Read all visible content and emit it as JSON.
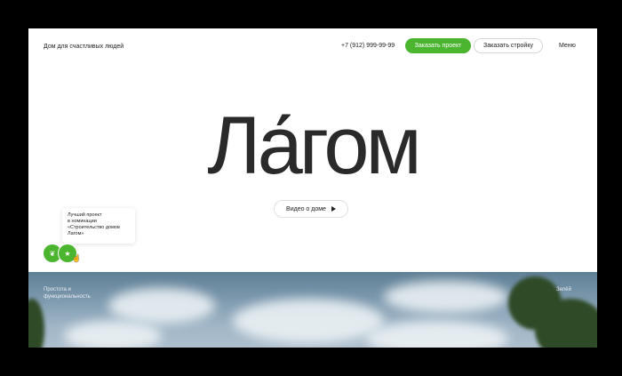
{
  "header": {
    "tagline": "Дом для счастливых людей",
    "phone": "+7 (912) 999-99-99",
    "order_project_label": "Заказать проект",
    "order_build_label": "Заказать стройку",
    "menu_label": "Меню",
    "accent_color": "#4cb530"
  },
  "hero": {
    "logo": "Ла́гом",
    "video_label": "Видео о доме",
    "video_icon": "play-icon"
  },
  "award": {
    "lines": [
      "Лучший проект",
      "в номинации",
      "«Строительство домов",
      "Лагом»"
    ]
  },
  "badges": [
    {
      "icon": "leaf-icon",
      "glyph": "❦"
    },
    {
      "icon": "star-icon",
      "glyph": "★"
    }
  ],
  "photo": {
    "caption_lines": [
      "Простота и",
      "функциональность"
    ],
    "right_label": "Зелёй"
  }
}
